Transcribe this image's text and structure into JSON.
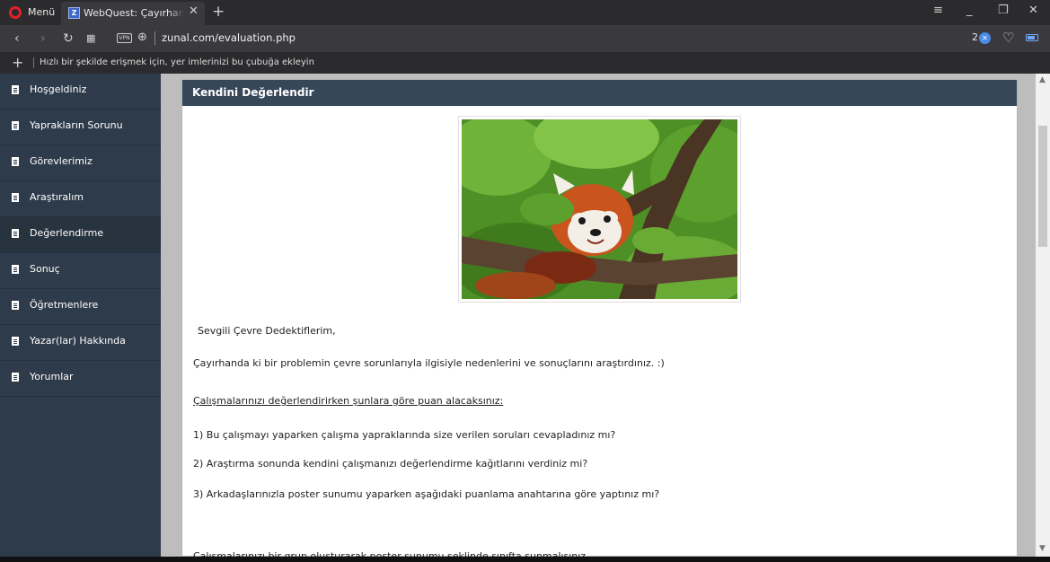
{
  "browser": {
    "menu_label": "Menü",
    "tab_title": "WebQuest: Çayırhan'ın Çevre Sorunları",
    "tab_favicon": "Z",
    "url": "zunal.com/evaluation.php",
    "vpn_label": "VPN",
    "ad_block_count": "2",
    "bookmarks_hint": "Hızlı bir şekilde erişmek için, yer imlerinizi bu çubuğa ekleyin",
    "icons": [
      "opera-logo-icon",
      "close-icon",
      "plus-icon",
      "back-icon",
      "forward-icon",
      "reload-icon",
      "speed-dial-icon",
      "globe-icon",
      "heart-icon",
      "battery-icon",
      "minimize-icon",
      "restore-icon",
      "window-close-icon",
      "tab-menu-icon"
    ]
  },
  "sidebar": {
    "items": [
      {
        "label": "Hoşgeldiniz"
      },
      {
        "label": "Yaprakların Sorunu"
      },
      {
        "label": "Görevlerimiz"
      },
      {
        "label": "Araştıralım"
      },
      {
        "label": "Değerlendirme"
      },
      {
        "label": "Sonuç"
      },
      {
        "label": "Öğretmenlere"
      },
      {
        "label": "Yazar(lar) Hakkında"
      },
      {
        "label": "Yorumlar"
      }
    ],
    "active_label": "Değerlendirme"
  },
  "content": {
    "title": "Kendini Değerlendir",
    "greeting": "Sevgili Çevre Dedektiflerim,",
    "intro": "Çayırhanda ki bir problemin çevre sorunlarıyla ilgisiyle nedenlerini ve sonuçlarını araştırdınız. :)",
    "criteria_heading": "Çalışmalarınızı değerlendirirken şunlara göre puan alacaksınız:",
    "items": [
      "1) Bu çalışmayı yaparken çalışma yapraklarında size verilen soruları cevapladınız mı?",
      "2) Araştırma sonunda kendini çalışmanızı değerlendirme kağıtlarını verdiniz mi?",
      "3) Arkadaşlarınızla poster sunumu yaparken aşağıdaki puanlama anahtarına göre yaptınız mı?"
    ],
    "cut_off_line": "Çalışmalarınızı bir grup oluşturarak poster sunumu şeklinde sınıfta sunmalısınız."
  },
  "colors": {
    "sidebar_bg": "#2e3b4a",
    "panel_header_bg": "#36475a",
    "page_bg": "#bdbdbd",
    "opera_red": "#e0202c"
  }
}
